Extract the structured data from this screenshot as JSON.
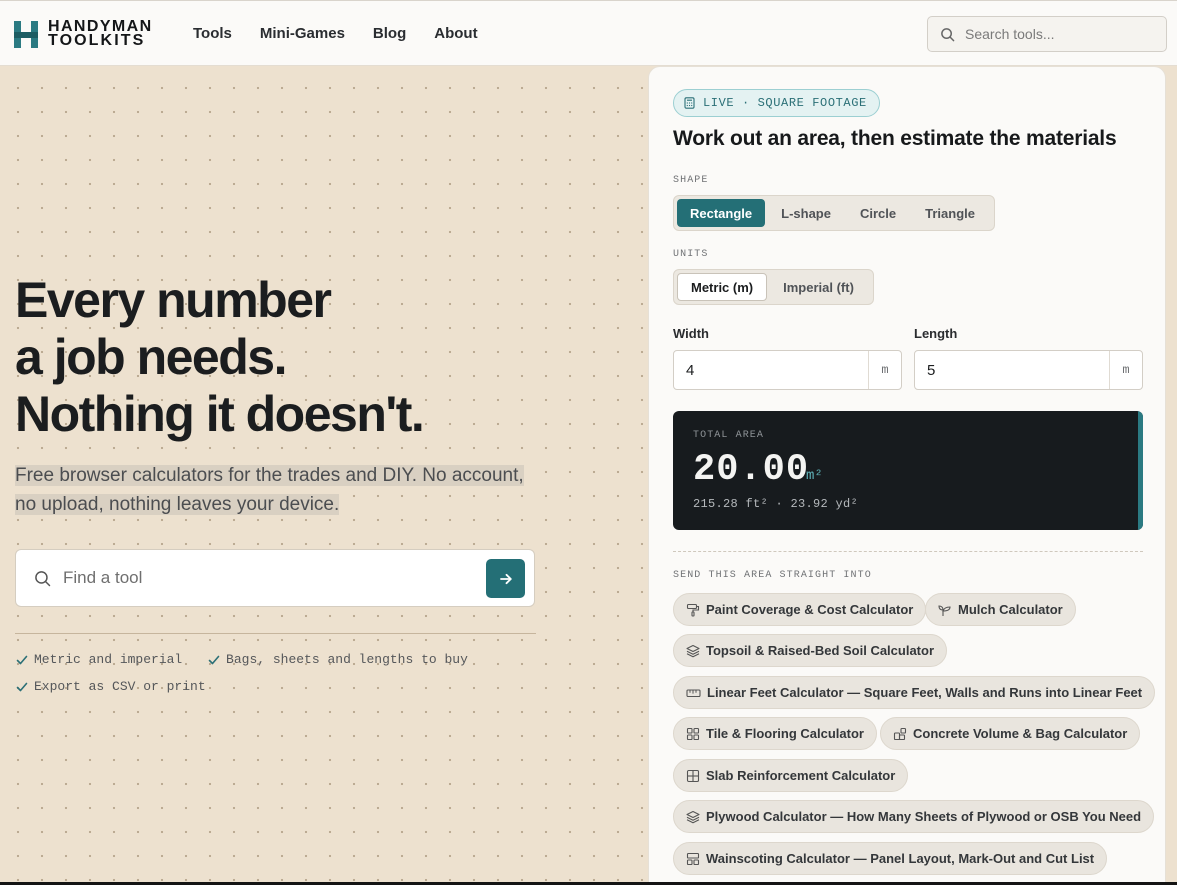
{
  "brand": {
    "line1": "HANDYMAN",
    "line2": "TOOLKITS",
    "color": "#2b7a82"
  },
  "nav": {
    "items": [
      "Tools",
      "Mini-Games",
      "Blog",
      "About"
    ]
  },
  "top_search": {
    "placeholder": "Search tools..."
  },
  "hero": {
    "title_lines": [
      "Every number",
      "a job needs.",
      "Nothing it doesn't."
    ],
    "subtitle": "Free browser calculators for the trades and DIY. No account, no upload, nothing leaves your device.",
    "find_placeholder": "Find a tool",
    "features": [
      "Metric and imperial",
      "Bags, sheets and lengths to buy",
      "Export as CSV or print"
    ]
  },
  "panel": {
    "badge": "LIVE · SQUARE FOOTAGE",
    "title": "Work out an area, then estimate the materials",
    "shape_label": "SHAPE",
    "shapes": [
      "Rectangle",
      "L-shape",
      "Circle",
      "Triangle"
    ],
    "shape_selected": "Rectangle",
    "units_label": "UNITS",
    "units": [
      "Metric (m)",
      "Imperial (ft)"
    ],
    "unit_selected": "Metric (m)",
    "width": {
      "label": "Width",
      "value": "4",
      "unit": "m"
    },
    "length": {
      "label": "Length",
      "value": "5",
      "unit": "m"
    },
    "total": {
      "label": "TOTAL AREA",
      "value": "20.00",
      "unit": "m²",
      "conversions": "215.28 ft² · 23.92 yd²"
    },
    "send_label": "SEND THIS AREA STRAIGHT INTO",
    "tools": [
      {
        "label": "Paint Coverage & Cost Calculator",
        "icon": "paint-roller-icon"
      },
      {
        "label": "Mulch Calculator",
        "icon": "sprout-icon"
      },
      {
        "label": "Topsoil & Raised-Bed Soil Calculator",
        "icon": "layers-icon"
      },
      {
        "label": "Linear Feet Calculator — Square Feet, Walls and Runs into Linear Feet",
        "icon": "ruler-icon"
      },
      {
        "label": "Tile & Flooring Calculator",
        "icon": "grid-icon"
      },
      {
        "label": "Concrete Volume & Bag Calculator",
        "icon": "blocks-icon"
      },
      {
        "label": "Slab Reinforcement Calculator",
        "icon": "grid-square-icon"
      },
      {
        "label": "Plywood Calculator — How Many Sheets of Plywood or OSB You Need",
        "icon": "layers-icon"
      },
      {
        "label": "Wainscoting Calculator — Panel Layout, Mark-Out and Cut List",
        "icon": "panels-icon"
      }
    ]
  }
}
